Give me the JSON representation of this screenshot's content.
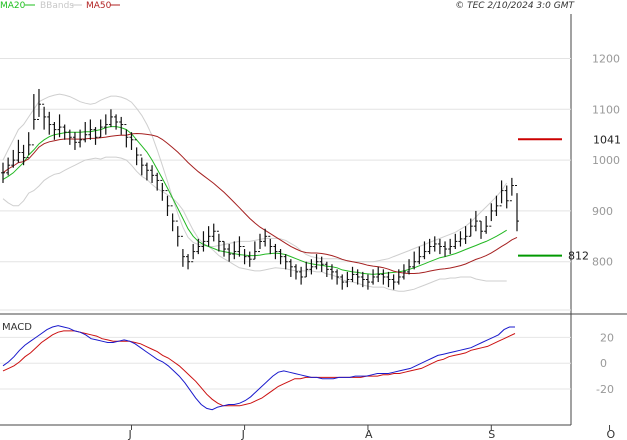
{
  "header": {
    "copyright": "© TEC 2/10/2024 3:0 GMT"
  },
  "legend": [
    {
      "label": "MA20",
      "color": "#1fbf1f"
    },
    {
      "label": "BBands",
      "color": "#c8c8c8"
    },
    {
      "label": "MA50",
      "color": "#b22222"
    }
  ],
  "markers": [
    {
      "label": "1041",
      "value": 1041,
      "color": "#cc0000"
    },
    {
      "label": "812",
      "value": 812,
      "color": "#009900"
    }
  ],
  "chart_data": [
    {
      "type": "candlestick",
      "price_axis": {
        "ticks": [
          800,
          900,
          1000,
          1100,
          1200
        ],
        "ylim": [
          705,
          1260
        ]
      },
      "x_labels": [
        "J",
        "J",
        "A",
        "S",
        "O"
      ],
      "x_label_index": [
        25,
        47,
        71,
        95,
        118
      ],
      "legend_placement": "top-left",
      "grid": true,
      "close": [
        975,
        990,
        1000,
        1015,
        1005,
        1030,
        1080,
        1110,
        1085,
        1070,
        1060,
        1065,
        1055,
        1045,
        1035,
        1040,
        1050,
        1060,
        1045,
        1065,
        1070,
        1085,
        1075,
        1070,
        1045,
        1040,
        1010,
        990,
        980,
        970,
        960,
        940,
        910,
        880,
        850,
        810,
        800,
        820,
        830,
        840,
        850,
        860,
        840,
        825,
        815,
        820,
        830,
        810,
        805,
        820,
        840,
        850,
        830,
        820,
        810,
        800,
        790,
        780,
        770,
        785,
        790,
        800,
        795,
        785,
        780,
        770,
        760,
        765,
        775,
        770,
        765,
        760,
        770,
        775,
        770,
        765,
        760,
        770,
        780,
        790,
        800,
        810,
        820,
        830,
        835,
        830,
        825,
        830,
        840,
        845,
        850,
        870,
        880,
        860,
        870,
        900,
        910,
        940,
        920,
        950,
        880
      ],
      "high": [
        995,
        1005,
        1020,
        1040,
        1030,
        1055,
        1130,
        1140,
        1105,
        1095,
        1075,
        1090,
        1070,
        1060,
        1055,
        1060,
        1075,
        1080,
        1065,
        1080,
        1090,
        1100,
        1090,
        1085,
        1060,
        1055,
        1025,
        1005,
        995,
        990,
        975,
        955,
        930,
        895,
        870,
        825,
        815,
        835,
        845,
        860,
        870,
        875,
        855,
        840,
        835,
        840,
        850,
        825,
        820,
        840,
        855,
        865,
        845,
        835,
        825,
        815,
        805,
        795,
        790,
        800,
        805,
        815,
        810,
        800,
        795,
        785,
        775,
        780,
        790,
        785,
        780,
        775,
        785,
        790,
        785,
        780,
        775,
        785,
        795,
        805,
        820,
        830,
        840,
        845,
        850,
        845,
        840,
        845,
        855,
        860,
        870,
        885,
        900,
        880,
        890,
        915,
        930,
        960,
        950,
        965,
        935
      ],
      "low": [
        955,
        970,
        985,
        995,
        990,
        1010,
        1060,
        1085,
        1060,
        1050,
        1040,
        1045,
        1040,
        1030,
        1020,
        1025,
        1035,
        1040,
        1030,
        1045,
        1050,
        1065,
        1060,
        1050,
        1025,
        1020,
        990,
        970,
        960,
        955,
        940,
        920,
        890,
        860,
        830,
        790,
        785,
        805,
        815,
        820,
        830,
        840,
        820,
        810,
        800,
        805,
        810,
        795,
        790,
        805,
        825,
        830,
        815,
        805,
        795,
        785,
        770,
        765,
        755,
        770,
        775,
        785,
        780,
        770,
        765,
        755,
        745,
        750,
        760,
        755,
        750,
        745,
        755,
        760,
        755,
        750,
        745,
        755,
        765,
        775,
        785,
        795,
        805,
        815,
        820,
        815,
        810,
        815,
        825,
        830,
        835,
        850,
        860,
        845,
        855,
        880,
        890,
        915,
        905,
        930,
        860
      ],
      "ma20": [
        962,
        968,
        975,
        985,
        995,
        1010,
        1020,
        1032,
        1040,
        1046,
        1050,
        1052,
        1054,
        1055,
        1055,
        1055,
        1056,
        1056,
        1058,
        1060,
        1064,
        1066,
        1066,
        1064,
        1060,
        1052,
        1040,
        1028,
        1016,
        1000,
        982,
        964,
        945,
        925,
        905,
        885,
        865,
        850,
        840,
        834,
        830,
        826,
        822,
        820,
        818,
        816,
        814,
        813,
        812,
        812,
        813,
        815,
        816,
        817,
        816,
        814,
        810,
        806,
        802,
        798,
        796,
        794,
        793,
        791,
        790,
        788,
        784,
        782,
        780,
        779,
        777,
        776,
        775,
        776,
        777,
        778,
        779,
        780,
        782,
        785,
        788,
        792,
        796,
        800,
        804,
        808,
        810,
        813,
        816,
        820,
        824,
        828,
        832,
        836,
        840,
        845,
        850,
        856,
        862
      ],
      "bb_upper": [
        1000,
        1020,
        1040,
        1060,
        1070,
        1085,
        1100,
        1115,
        1120,
        1125,
        1128,
        1130,
        1128,
        1125,
        1120,
        1115,
        1112,
        1110,
        1112,
        1118,
        1122,
        1126,
        1126,
        1124,
        1120,
        1114,
        1102,
        1088,
        1070,
        1048,
        1020,
        990,
        958,
        925,
        895,
        868,
        848,
        838,
        834,
        832,
        830,
        830,
        832,
        834,
        836,
        838,
        840,
        840,
        840,
        842,
        844,
        846,
        846,
        846,
        845,
        842,
        836,
        830,
        822,
        814,
        810,
        808,
        806,
        806,
        806,
        806,
        804,
        802,
        800,
        800,
        800,
        800,
        800,
        802,
        804,
        806,
        810,
        814,
        818,
        822,
        826,
        830,
        834,
        838,
        842,
        846,
        850,
        854,
        858,
        864,
        870,
        878,
        888,
        898,
        908,
        918,
        928,
        940,
        955
      ],
      "bb_lower": [
        924,
        916,
        910,
        910,
        920,
        935,
        940,
        949,
        960,
        967,
        972,
        974,
        980,
        985,
        990,
        995,
        1000,
        1002,
        1004,
        1002,
        1006,
        1006,
        1006,
        1004,
        1000,
        990,
        978,
        968,
        962,
        952,
        944,
        938,
        932,
        925,
        915,
        902,
        882,
        862,
        846,
        836,
        830,
        822,
        812,
        806,
        800,
        794,
        788,
        786,
        784,
        782,
        782,
        784,
        786,
        788,
        787,
        786,
        784,
        782,
        782,
        782,
        782,
        780,
        780,
        776,
        774,
        770,
        764,
        762,
        760,
        758,
        754,
        752,
        750,
        750,
        750,
        746,
        744,
        742,
        742,
        744,
        746,
        750,
        754,
        758,
        762,
        766,
        766,
        768,
        768,
        770,
        770,
        770,
        766,
        764,
        762,
        762,
        762,
        762,
        762
      ]
    },
    {
      "type": "line",
      "title": "MACD",
      "y_ticks": [
        20,
        0,
        -20
      ],
      "ylim": [
        -44,
        35
      ],
      "series": [
        {
          "values": [
            -2,
            1,
            5,
            10,
            14,
            17,
            20,
            23,
            26,
            28,
            29,
            28,
            27,
            25,
            24,
            22,
            19,
            18,
            17,
            16,
            16,
            17,
            18,
            17,
            15,
            12,
            9,
            6,
            3,
            1,
            -2,
            -6,
            -10,
            -15,
            -21,
            -27,
            -32,
            -35,
            -36,
            -34,
            -33,
            -32,
            -32,
            -31,
            -29,
            -26,
            -22,
            -18,
            -14,
            -10,
            -7,
            -6,
            -7,
            -8,
            -9,
            -10,
            -11,
            -11,
            -12,
            -12,
            -12,
            -11,
            -11,
            -11,
            -10,
            -10,
            -10,
            -9,
            -8,
            -8,
            -8,
            -7,
            -6,
            -5,
            -4,
            -2,
            0,
            2,
            4,
            6,
            7,
            8,
            9,
            10,
            11,
            12,
            14,
            16,
            18,
            20,
            22,
            26,
            28,
            28
          ]
        },
        {
          "values": [
            -6,
            -4,
            -2,
            1,
            5,
            8,
            12,
            16,
            19,
            22,
            24,
            25,
            25,
            25,
            24,
            23,
            22,
            21,
            19,
            18,
            17,
            17,
            17,
            17,
            16,
            15,
            13,
            11,
            9,
            6,
            4,
            1,
            -2,
            -6,
            -10,
            -14,
            -19,
            -24,
            -28,
            -31,
            -33,
            -33,
            -33,
            -33,
            -32,
            -31,
            -29,
            -27,
            -24,
            -21,
            -18,
            -16,
            -14,
            -12,
            -12,
            -11,
            -11,
            -11,
            -11,
            -11,
            -11,
            -11,
            -11,
            -11,
            -11,
            -11,
            -10,
            -10,
            -10,
            -9,
            -9,
            -8,
            -8,
            -7,
            -6,
            -5,
            -4,
            -2,
            0,
            2,
            3,
            5,
            6,
            7,
            8,
            10,
            11,
            12,
            13,
            15,
            17,
            19,
            21,
            23
          ]
        }
      ]
    }
  ]
}
